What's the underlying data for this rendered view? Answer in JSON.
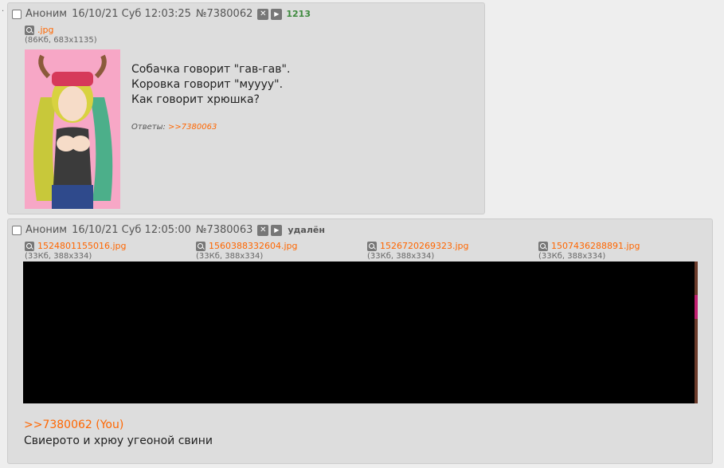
{
  "posts": [
    {
      "name": "Аноним",
      "date": "16/10/21 Суб 12:03:25",
      "number": "№7380062",
      "count": "1213",
      "file": {
        "name": ".jpg",
        "meta": "(86Кб, 683x1135)"
      },
      "message": [
        "Собачка говорит \"гав-гав\".",
        "Коровка говорит \"муууу\".",
        "Как говорит хрюшка?"
      ],
      "replies_label": "Ответы:",
      "replies_link": ">>7380063"
    },
    {
      "name": "Аноним",
      "date": "16/10/21 Суб 12:05:00",
      "number": "№7380063",
      "status": "удалён",
      "files": [
        {
          "name": "1524801155016.jpg",
          "meta": "(33Кб, 388x334)"
        },
        {
          "name": "1560388332604.jpg",
          "meta": "(33Кб, 388x334)"
        },
        {
          "name": "1526720269323.jpg",
          "meta": "(33Кб, 388x334)"
        },
        {
          "name": "1507436288891.jpg",
          "meta": "(33Кб, 388x334)"
        }
      ],
      "reply_ref": ">>7380062 (You)",
      "message": "Свиерото и хрюу угеоной свини"
    }
  ],
  "icons": {
    "close": "close-icon",
    "play": "play-icon",
    "search": "magnifier-icon"
  },
  "colors": {
    "link": "#ff6600",
    "count": "#3d8a3d",
    "post_bg": "#dddddd",
    "page_bg": "#eeeeee"
  }
}
